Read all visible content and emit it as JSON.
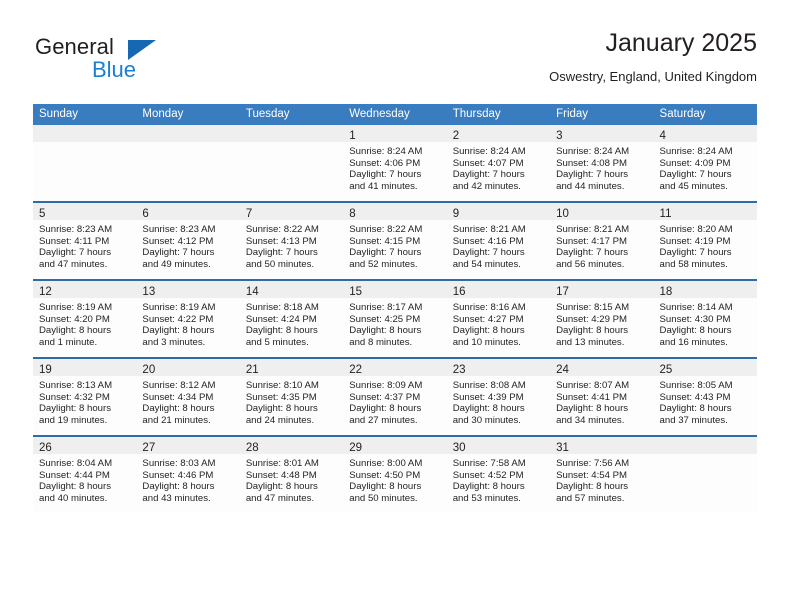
{
  "brand": {
    "name_part1": "General",
    "name_part2": "Blue",
    "triangle_color": "#1668b3",
    "blue_color": "#1b7fd4"
  },
  "header": {
    "title": "January 2025",
    "subtitle": "Oswestry, England, United Kingdom"
  },
  "theme": {
    "header_bg": "#3a7cc0",
    "row_divider": "#2d6ca8",
    "day_band_bg": "#efefef",
    "text": "#231f20"
  },
  "weekdays": [
    "Sunday",
    "Monday",
    "Tuesday",
    "Wednesday",
    "Thursday",
    "Friday",
    "Saturday"
  ],
  "weeks": [
    [
      {
        "day": "",
        "lines": []
      },
      {
        "day": "",
        "lines": []
      },
      {
        "day": "",
        "lines": []
      },
      {
        "day": "1",
        "lines": [
          "Sunrise: 8:24 AM",
          "Sunset: 4:06 PM",
          "Daylight: 7 hours",
          "and 41 minutes."
        ]
      },
      {
        "day": "2",
        "lines": [
          "Sunrise: 8:24 AM",
          "Sunset: 4:07 PM",
          "Daylight: 7 hours",
          "and 42 minutes."
        ]
      },
      {
        "day": "3",
        "lines": [
          "Sunrise: 8:24 AM",
          "Sunset: 4:08 PM",
          "Daylight: 7 hours",
          "and 44 minutes."
        ]
      },
      {
        "day": "4",
        "lines": [
          "Sunrise: 8:24 AM",
          "Sunset: 4:09 PM",
          "Daylight: 7 hours",
          "and 45 minutes."
        ]
      }
    ],
    [
      {
        "day": "5",
        "lines": [
          "Sunrise: 8:23 AM",
          "Sunset: 4:11 PM",
          "Daylight: 7 hours",
          "and 47 minutes."
        ]
      },
      {
        "day": "6",
        "lines": [
          "Sunrise: 8:23 AM",
          "Sunset: 4:12 PM",
          "Daylight: 7 hours",
          "and 49 minutes."
        ]
      },
      {
        "day": "7",
        "lines": [
          "Sunrise: 8:22 AM",
          "Sunset: 4:13 PM",
          "Daylight: 7 hours",
          "and 50 minutes."
        ]
      },
      {
        "day": "8",
        "lines": [
          "Sunrise: 8:22 AM",
          "Sunset: 4:15 PM",
          "Daylight: 7 hours",
          "and 52 minutes."
        ]
      },
      {
        "day": "9",
        "lines": [
          "Sunrise: 8:21 AM",
          "Sunset: 4:16 PM",
          "Daylight: 7 hours",
          "and 54 minutes."
        ]
      },
      {
        "day": "10",
        "lines": [
          "Sunrise: 8:21 AM",
          "Sunset: 4:17 PM",
          "Daylight: 7 hours",
          "and 56 minutes."
        ]
      },
      {
        "day": "11",
        "lines": [
          "Sunrise: 8:20 AM",
          "Sunset: 4:19 PM",
          "Daylight: 7 hours",
          "and 58 minutes."
        ]
      }
    ],
    [
      {
        "day": "12",
        "lines": [
          "Sunrise: 8:19 AM",
          "Sunset: 4:20 PM",
          "Daylight: 8 hours",
          "and 1 minute."
        ]
      },
      {
        "day": "13",
        "lines": [
          "Sunrise: 8:19 AM",
          "Sunset: 4:22 PM",
          "Daylight: 8 hours",
          "and 3 minutes."
        ]
      },
      {
        "day": "14",
        "lines": [
          "Sunrise: 8:18 AM",
          "Sunset: 4:24 PM",
          "Daylight: 8 hours",
          "and 5 minutes."
        ]
      },
      {
        "day": "15",
        "lines": [
          "Sunrise: 8:17 AM",
          "Sunset: 4:25 PM",
          "Daylight: 8 hours",
          "and 8 minutes."
        ]
      },
      {
        "day": "16",
        "lines": [
          "Sunrise: 8:16 AM",
          "Sunset: 4:27 PM",
          "Daylight: 8 hours",
          "and 10 minutes."
        ]
      },
      {
        "day": "17",
        "lines": [
          "Sunrise: 8:15 AM",
          "Sunset: 4:29 PM",
          "Daylight: 8 hours",
          "and 13 minutes."
        ]
      },
      {
        "day": "18",
        "lines": [
          "Sunrise: 8:14 AM",
          "Sunset: 4:30 PM",
          "Daylight: 8 hours",
          "and 16 minutes."
        ]
      }
    ],
    [
      {
        "day": "19",
        "lines": [
          "Sunrise: 8:13 AM",
          "Sunset: 4:32 PM",
          "Daylight: 8 hours",
          "and 19 minutes."
        ]
      },
      {
        "day": "20",
        "lines": [
          "Sunrise: 8:12 AM",
          "Sunset: 4:34 PM",
          "Daylight: 8 hours",
          "and 21 minutes."
        ]
      },
      {
        "day": "21",
        "lines": [
          "Sunrise: 8:10 AM",
          "Sunset: 4:35 PM",
          "Daylight: 8 hours",
          "and 24 minutes."
        ]
      },
      {
        "day": "22",
        "lines": [
          "Sunrise: 8:09 AM",
          "Sunset: 4:37 PM",
          "Daylight: 8 hours",
          "and 27 minutes."
        ]
      },
      {
        "day": "23",
        "lines": [
          "Sunrise: 8:08 AM",
          "Sunset: 4:39 PM",
          "Daylight: 8 hours",
          "and 30 minutes."
        ]
      },
      {
        "day": "24",
        "lines": [
          "Sunrise: 8:07 AM",
          "Sunset: 4:41 PM",
          "Daylight: 8 hours",
          "and 34 minutes."
        ]
      },
      {
        "day": "25",
        "lines": [
          "Sunrise: 8:05 AM",
          "Sunset: 4:43 PM",
          "Daylight: 8 hours",
          "and 37 minutes."
        ]
      }
    ],
    [
      {
        "day": "26",
        "lines": [
          "Sunrise: 8:04 AM",
          "Sunset: 4:44 PM",
          "Daylight: 8 hours",
          "and 40 minutes."
        ]
      },
      {
        "day": "27",
        "lines": [
          "Sunrise: 8:03 AM",
          "Sunset: 4:46 PM",
          "Daylight: 8 hours",
          "and 43 minutes."
        ]
      },
      {
        "day": "28",
        "lines": [
          "Sunrise: 8:01 AM",
          "Sunset: 4:48 PM",
          "Daylight: 8 hours",
          "and 47 minutes."
        ]
      },
      {
        "day": "29",
        "lines": [
          "Sunrise: 8:00 AM",
          "Sunset: 4:50 PM",
          "Daylight: 8 hours",
          "and 50 minutes."
        ]
      },
      {
        "day": "30",
        "lines": [
          "Sunrise: 7:58 AM",
          "Sunset: 4:52 PM",
          "Daylight: 8 hours",
          "and 53 minutes."
        ]
      },
      {
        "day": "31",
        "lines": [
          "Sunrise: 7:56 AM",
          "Sunset: 4:54 PM",
          "Daylight: 8 hours",
          "and 57 minutes."
        ]
      },
      {
        "day": "",
        "lines": []
      }
    ]
  ]
}
